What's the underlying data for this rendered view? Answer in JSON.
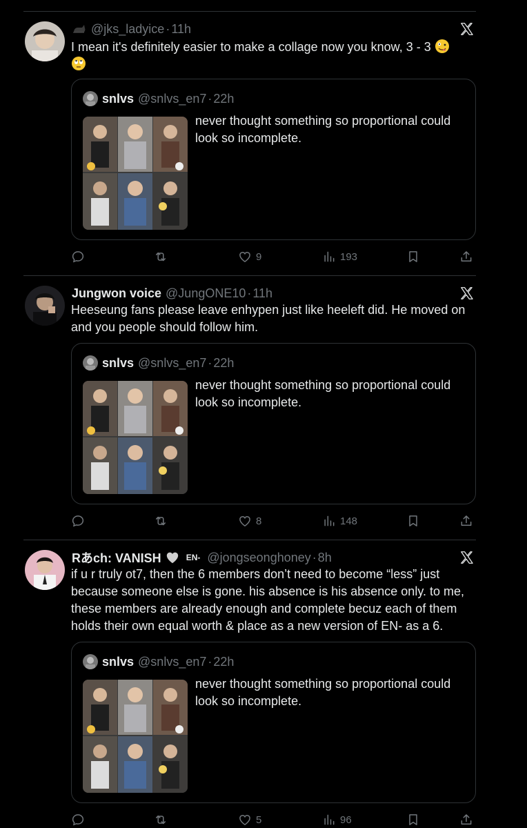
{
  "tweets": [
    {
      "name": "",
      "handle": "@jks_ladyice",
      "separator": "·",
      "time": "11h",
      "text": "I mean it's definitely easier to make a collage now you know, 3 - 3",
      "quote": {
        "name": "snlvs",
        "handle": "@snlvs_en7",
        "separator": "·",
        "time": "22h",
        "text": "never thought something so proportional could look so incomplete."
      },
      "likes": "9",
      "views": "193"
    },
    {
      "name": "Jungwon voice",
      "handle": "@JungONE10",
      "separator": "·",
      "time": "11h",
      "text": "Heeseung fans please leave enhypen just like heeleft did. He moved on and you people should follow him.",
      "quote": {
        "name": "snlvs",
        "handle": "@snlvs_en7",
        "separator": "·",
        "time": "22h",
        "text": "never thought something so proportional could look so incomplete."
      },
      "likes": "8",
      "views": "148"
    },
    {
      "name": "Rあch: VANISH",
      "badge": "EN-",
      "handle": "@jongseonghoney",
      "separator": "·",
      "time": "8h",
      "text": "if u r truly ot7, then the 6 members don’t need to become “less” just because someone else is gone. his absence is his absence only. to me, these members are already enough and complete becuz each of them holds their own equal worth & place as a new version of EN- as a 6.",
      "quote": {
        "name": "snlvs",
        "handle": "@snlvs_en7",
        "separator": "·",
        "time": "22h",
        "text": "never thought something so proportional could look so incomplete."
      },
      "likes": "5",
      "views": "96"
    }
  ],
  "colors": {
    "background": "#000000",
    "text": "#e7e9ea",
    "muted": "#71767b",
    "border": "#2f3336"
  },
  "icons": [
    "reply-icon",
    "retweet-icon",
    "heart-icon",
    "views-icon",
    "bookmark-icon",
    "share-icon",
    "x-logo-icon",
    "cat-emoji",
    "grey-heart-emoji",
    "zany-face-emoji",
    "rolling-eyes-emoji"
  ]
}
